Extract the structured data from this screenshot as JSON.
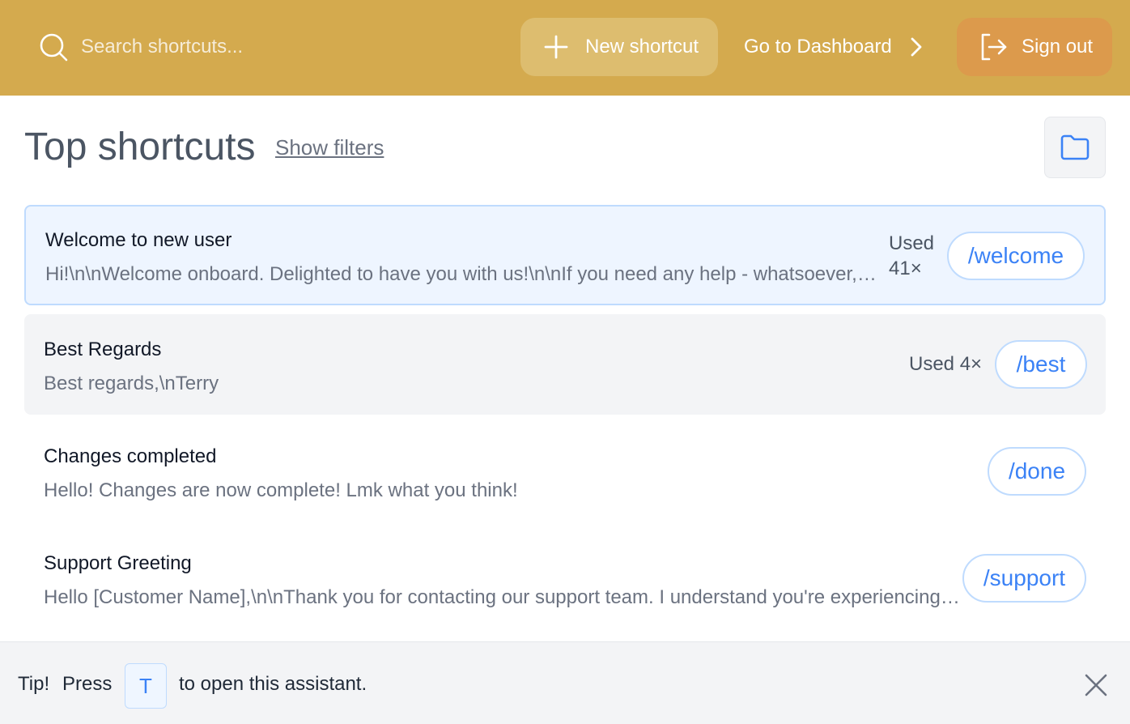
{
  "header": {
    "search_placeholder": "Search shortcuts...",
    "new_shortcut_label": "New shortcut",
    "dashboard_label": "Go to Dashboard",
    "sign_out_label": "Sign out"
  },
  "main": {
    "title": "Top shortcuts",
    "show_filters_label": "Show filters"
  },
  "shortcuts": [
    {
      "title": "Welcome to new user",
      "description": "Hi!\\n\\nWelcome onboard. Delighted to have you with us!\\n\\nIf you need any help - whatsoever, please reach out.",
      "used_line1": "Used",
      "used_line2": "41×",
      "command": "/welcome"
    },
    {
      "title": "Best Regards",
      "description": "Best regards,\\nTerry",
      "used": "Used 4×",
      "command": "/best"
    },
    {
      "title": "Changes completed",
      "description": "Hello! Changes are now complete! Lmk what you think!",
      "command": "/done"
    },
    {
      "title": "Support Greeting",
      "description": "Hello [Customer Name],\\n\\nThank you for contacting our support team. I understand you're experiencing an issue.",
      "command": "/support"
    }
  ],
  "tip": {
    "label": "Tip!",
    "press": "Press",
    "key": "T",
    "rest": "to open this assistant."
  },
  "colors": {
    "header_bg": "#d4aa4e",
    "new_button_bg": "#ddbd6f",
    "sign_out_bg": "#dc9a4c",
    "accent_blue": "#3b82f6"
  }
}
